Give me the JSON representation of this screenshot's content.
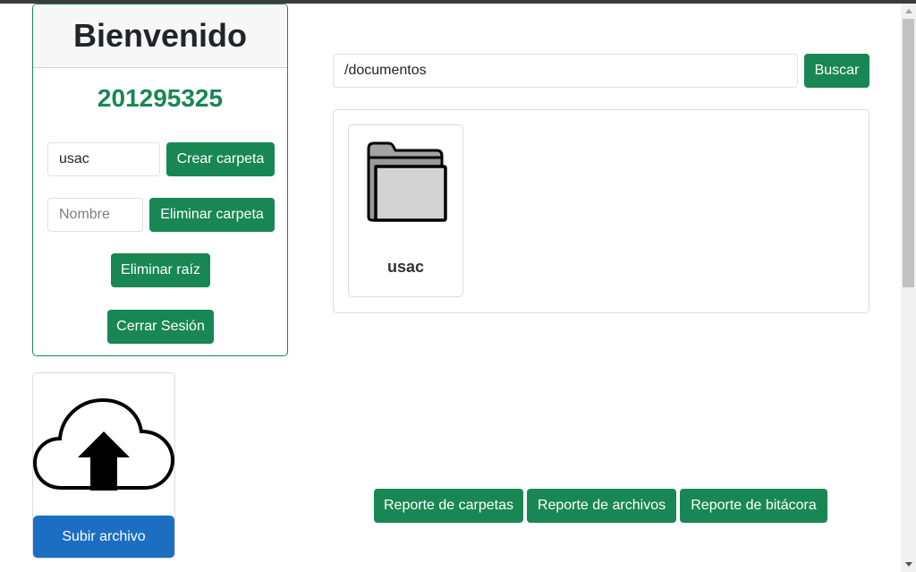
{
  "welcome": {
    "title": "Bienvenido",
    "user_code": "201295325",
    "create_folder": {
      "input_value": "usac",
      "button_label": "Crear carpeta"
    },
    "delete_folder": {
      "input_value": "",
      "placeholder": "Nombre",
      "button_label": "Eliminar carpeta"
    },
    "delete_root_label": "Eliminar raíz",
    "logout_label": "Cerrar Sesión"
  },
  "upload": {
    "button_label": "Subir archivo",
    "icon": "cloud-upload-icon"
  },
  "path_bar": {
    "value": "/documentos",
    "search_label": "Buscar"
  },
  "folders": [
    {
      "name": "usac",
      "icon": "folder-icon"
    }
  ],
  "reports": {
    "folders_label": "Reporte de carpetas",
    "files_label": "Reporte de archivos",
    "log_label": "Reporte de bitácora"
  },
  "colors": {
    "primary_green": "#198754",
    "upload_blue": "#1b6ec2"
  }
}
